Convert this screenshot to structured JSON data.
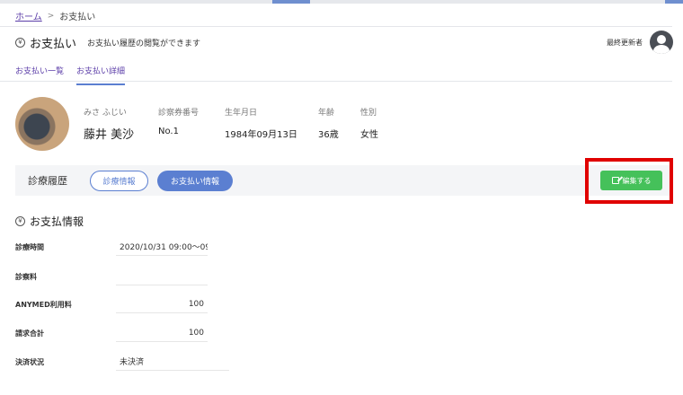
{
  "breadcrumb": {
    "home": "ホーム",
    "current": "お支払い"
  },
  "header": {
    "title": "お支払い",
    "description": "お支払い履歴の閲覧ができます",
    "updater_label": "最終更新者"
  },
  "tabs": [
    {
      "label": "お支払い一覧",
      "active": false
    },
    {
      "label": "お支払い詳細",
      "active": true
    }
  ],
  "patient": {
    "labels": {
      "kana": "みさ ふじい",
      "card_no": "診察券番号",
      "birthdate": "生年月日",
      "age": "年齢",
      "gender": "性別"
    },
    "values": {
      "name": "藤井 美沙",
      "card_no": "No.1",
      "birthdate": "1984年09月13日",
      "age": "36歳",
      "gender": "女性"
    }
  },
  "history": {
    "title": "診療履歴",
    "tabs": [
      {
        "label": "診療情報",
        "active": false
      },
      {
        "label": "お支払い情報",
        "active": true
      }
    ],
    "edit_button": "編集する"
  },
  "payment": {
    "title": "お支払情報",
    "fields": [
      {
        "label": "診療時間",
        "value": "2020/10/31  09:00〜09"
      },
      {
        "label": "診察料",
        "value": ""
      },
      {
        "label": "ANYMED利用料",
        "value": "100"
      },
      {
        "label": "請求合計",
        "value": "100"
      },
      {
        "label": "決済状況",
        "value": "未決済"
      }
    ]
  },
  "colors": {
    "accent": "#5b7fd1",
    "link": "#5b3da8",
    "edit_button": "#45c15a",
    "highlight": "#e00000"
  },
  "icons": {
    "section": "yen-circle-icon",
    "edit": "edit-icon",
    "avatar": "user-avatar-icon"
  }
}
